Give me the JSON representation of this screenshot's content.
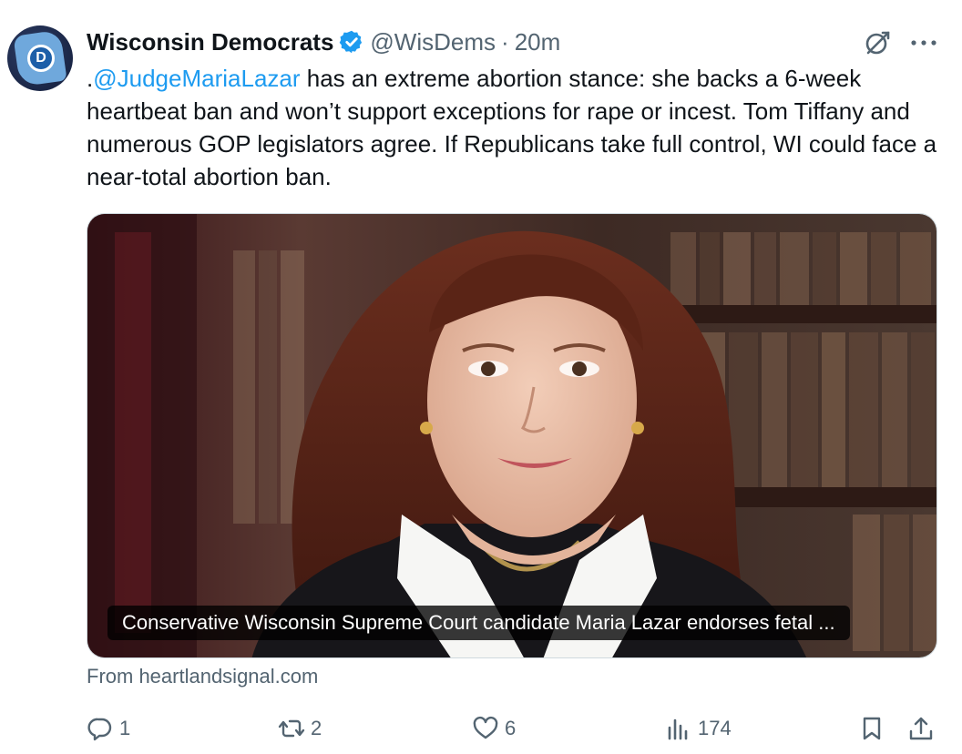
{
  "author": {
    "name": "Wisconsin Democrats",
    "handle": "@WisDems",
    "separator": "·",
    "time": "20m",
    "avatar_letter": "D"
  },
  "tweet": {
    "prefix": ".",
    "mention": "@JudgeMariaLazar",
    "text": " has an extreme abortion stance: she backs a 6-week heartbeat ban and won’t support exceptions for rape or incest. Tom Tiffany and numerous GOP legislators agree. If Republicans take full control, WI could face a near-total abortion ban."
  },
  "card": {
    "caption": "Conservative Wisconsin Supreme Court candidate Maria Lazar endorses fetal ...",
    "source": "From heartlandsignal.com"
  },
  "actions": {
    "replies": "1",
    "reposts": "2",
    "likes": "6",
    "views": "174"
  },
  "colors": {
    "link": "#1d9bf0",
    "secondary_text": "#536471",
    "verified_badge": "#1d9bf0"
  },
  "icons": [
    "verified-badge-icon",
    "grok-icon",
    "more-icon",
    "reply-icon",
    "repost-icon",
    "like-icon",
    "views-icon",
    "bookmark-icon",
    "share-icon"
  ]
}
